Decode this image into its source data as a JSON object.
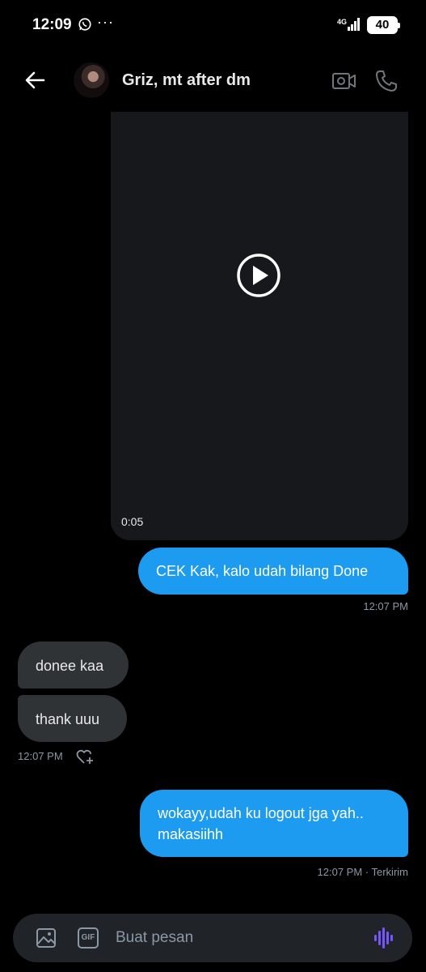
{
  "status_bar": {
    "time": "12:09",
    "more": "···",
    "network": "4G",
    "battery": "40"
  },
  "header": {
    "title": "Griz, mt after dm",
    "icons": [
      "back-arrow-icon",
      "avatar",
      "video-camera-icon",
      "phone-icon"
    ]
  },
  "video": {
    "duration": "0:05",
    "icon": "play-icon"
  },
  "messages": [
    {
      "direction": "out",
      "text": "CEK Kak, kalo udah bilang Done",
      "meta": "12:07 PM"
    },
    {
      "direction": "in",
      "text": "donee kaa"
    },
    {
      "direction": "in",
      "text": "thank uuu",
      "meta": "12:07 PM"
    },
    {
      "direction": "out",
      "text": "wokayy,udah ku logout jga yah.. makasiihh",
      "meta": "12:07 PM · Terkirim"
    }
  ],
  "composer": {
    "placeholder": "Buat pesan",
    "gif_label": "GIF"
  },
  "colors": {
    "background": "#000000",
    "outgoing_bubble": "#1d9bf0",
    "incoming_bubble": "#2f3336",
    "voice_accent": "#7856ff"
  }
}
